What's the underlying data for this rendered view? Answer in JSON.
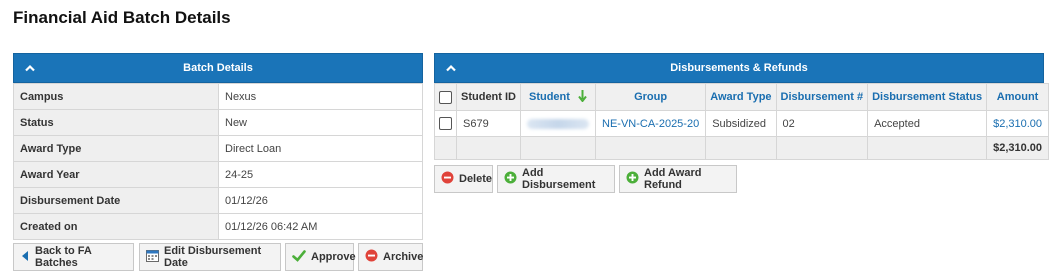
{
  "page": {
    "title": "Financial Aid Batch Details"
  },
  "batch_details": {
    "header": "Batch Details",
    "rows": [
      {
        "label": "Campus",
        "value": "Nexus"
      },
      {
        "label": "Status",
        "value": "New"
      },
      {
        "label": "Award Type",
        "value": "Direct Loan"
      },
      {
        "label": "Award Year",
        "value": "24-25"
      },
      {
        "label": "Disbursement Date",
        "value": "01/12/26"
      },
      {
        "label": "Created on",
        "value": "01/12/26 06:42 AM"
      }
    ],
    "buttons": {
      "back": "Back to FA Batches",
      "edit_date": "Edit Disbursement Date",
      "approve": "Approve",
      "archive": "Archive"
    }
  },
  "disbursements": {
    "header": "Disbursements & Refunds",
    "columns": {
      "student_id": "Student ID",
      "student": "Student",
      "group": "Group",
      "award_type": "Award Type",
      "disbursement_no": "Disbursement #",
      "disbursement_status": "Disbursement Status",
      "amount": "Amount"
    },
    "rows": [
      {
        "student_id": "S679",
        "group": "NE-VN-CA-2025-20",
        "award_type": "Subsidized",
        "disbursement_no": "02",
        "disbursement_status": "Accepted",
        "amount": "$2,310.00"
      }
    ],
    "total": "$2,310.00",
    "buttons": {
      "delete": "Delete",
      "add_disbursement": "Add Disbursement",
      "add_award_refund": "Add Award Refund"
    }
  },
  "icons": {
    "collapse": "chevron-up-icon",
    "sort": "arrow-down-icon",
    "back": "triangle-left-icon",
    "calendar": "calendar-icon",
    "approve": "checkmark-icon",
    "archive": "minus-circle-icon",
    "delete": "minus-circle-icon",
    "add": "plus-circle-icon"
  },
  "colors": {
    "header_blue": "#1a74b8",
    "link_blue": "#1a6eb0",
    "approve_green": "#4caf3a",
    "delete_red": "#e0433a"
  }
}
